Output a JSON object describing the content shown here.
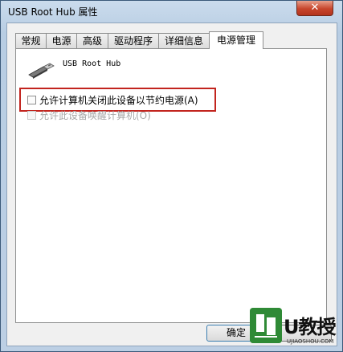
{
  "window": {
    "title": "USB Root Hub 属性",
    "close_label": "✕"
  },
  "tabs": [
    {
      "label": "常规",
      "active": false
    },
    {
      "label": "电源",
      "active": false
    },
    {
      "label": "高级",
      "active": false
    },
    {
      "label": "驱动程序",
      "active": false
    },
    {
      "label": "详细信息",
      "active": false
    },
    {
      "label": "电源管理",
      "active": true
    }
  ],
  "device": {
    "name": "USB Root Hub",
    "icon": "usb-connector-icon"
  },
  "options": [
    {
      "label": "允许计算机关闭此设备以节约电源(A)",
      "checked": false,
      "enabled": true
    },
    {
      "label": "允许此设备唤醒计算机(O)",
      "checked": false,
      "enabled": false
    }
  ],
  "buttons": {
    "ok_label": "确定",
    "cancel_label": ""
  },
  "watermark": {
    "brand": "U教授",
    "url": "UJIAOSHOU.COM"
  },
  "colors": {
    "highlight_border": "#c2241e",
    "close_button": "#c7452c",
    "watermark_green": "#2f8a36"
  }
}
